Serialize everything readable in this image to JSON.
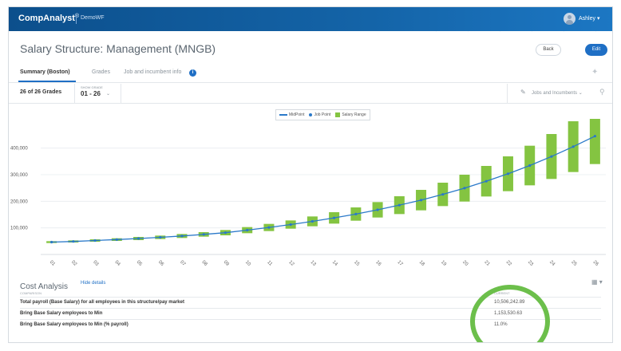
{
  "app": {
    "brand": "CompAnalyst",
    "brand_mark": "®",
    "tenant": "DemoWF",
    "user": "Ashley"
  },
  "page": {
    "title": "Salary Structure: Management (MNGB)",
    "back_label": "Back",
    "edit_label": "Edit"
  },
  "tabs": [
    {
      "label": "Summary (Boston)",
      "active": true
    },
    {
      "label": "Grades",
      "active": false
    },
    {
      "label": "Job and incumbent info",
      "active": false
    }
  ],
  "grades_bar": {
    "count_label": "26 of 26 Grades",
    "selector_caption": "SHOW GRADE",
    "selector_value": "01 - 26",
    "jobs_label": "Jobs and Incumbents"
  },
  "legend": {
    "midpoint": "MidPoint",
    "job_point": "Job Point",
    "salary_range": "Salary Range"
  },
  "colors": {
    "midpoint": "#2a79c9",
    "range": "#84c441",
    "annotation": "#6cbf4b",
    "header": "#0c4f8c"
  },
  "chart_data": {
    "type": "bar",
    "categories": [
      "01",
      "02",
      "03",
      "04",
      "05",
      "06",
      "07",
      "08",
      "09",
      "10",
      "11",
      "12",
      "13",
      "14",
      "15",
      "16",
      "17",
      "18",
      "19",
      "20",
      "21",
      "22",
      "23",
      "24",
      "25",
      "26"
    ],
    "series": [
      {
        "name": "Salary Range",
        "kind": "range",
        "min": [
          43000,
          45000,
          48000,
          51000,
          54000,
          58000,
          62000,
          67000,
          72000,
          80000,
          88000,
          97000,
          106000,
          116000,
          127000,
          139000,
          152000,
          166000,
          182000,
          199000,
          218000,
          238000,
          260000,
          284000,
          310000,
          340000
        ],
        "max": [
          50000,
          53000,
          57000,
          61000,
          66000,
          71000,
          77000,
          84000,
          92000,
          103000,
          115000,
          128000,
          143000,
          159000,
          177000,
          197000,
          219000,
          243000,
          270000,
          300000,
          333000,
          369000,
          409000,
          453000,
          501000,
          550000
        ]
      },
      {
        "name": "MidPoint",
        "kind": "line",
        "values": [
          46500,
          49000,
          52500,
          56000,
          60000,
          64500,
          69500,
          75500,
          82000,
          91500,
          101500,
          112500,
          124500,
          137500,
          152000,
          168000,
          185500,
          204500,
          226000,
          249500,
          275500,
          303500,
          334500,
          368500,
          405500,
          445000
        ]
      },
      {
        "name": "Job Point",
        "kind": "scatter",
        "values": [
          46500,
          49000,
          52500,
          56000,
          60000,
          64500,
          69500,
          75500,
          82000,
          91500,
          101500,
          112500,
          124500,
          137500,
          152000,
          168000,
          185500,
          204500,
          226000,
          249500,
          275500,
          303500,
          334500,
          368500,
          405500,
          445000
        ]
      }
    ],
    "yticks": [
      "400,000",
      "300,000",
      "200,000",
      "100,000"
    ],
    "ylim": [
      0,
      480000
    ]
  },
  "cost_analysis": {
    "title": "Cost Analysis",
    "hide_label": "Hide details",
    "col_comparison": "COMPARISON",
    "col_current": "CURRENT",
    "rows": [
      {
        "label": "Total payroll (Base Salary) for all employees in this structure/pay market",
        "value": "10,506,242.89"
      },
      {
        "label": "Bring Base Salary employees to Min",
        "value": "1,153,530.63"
      },
      {
        "label": "Bring Base Salary employees to Min (% payroll)",
        "value": "11.0%"
      }
    ]
  }
}
